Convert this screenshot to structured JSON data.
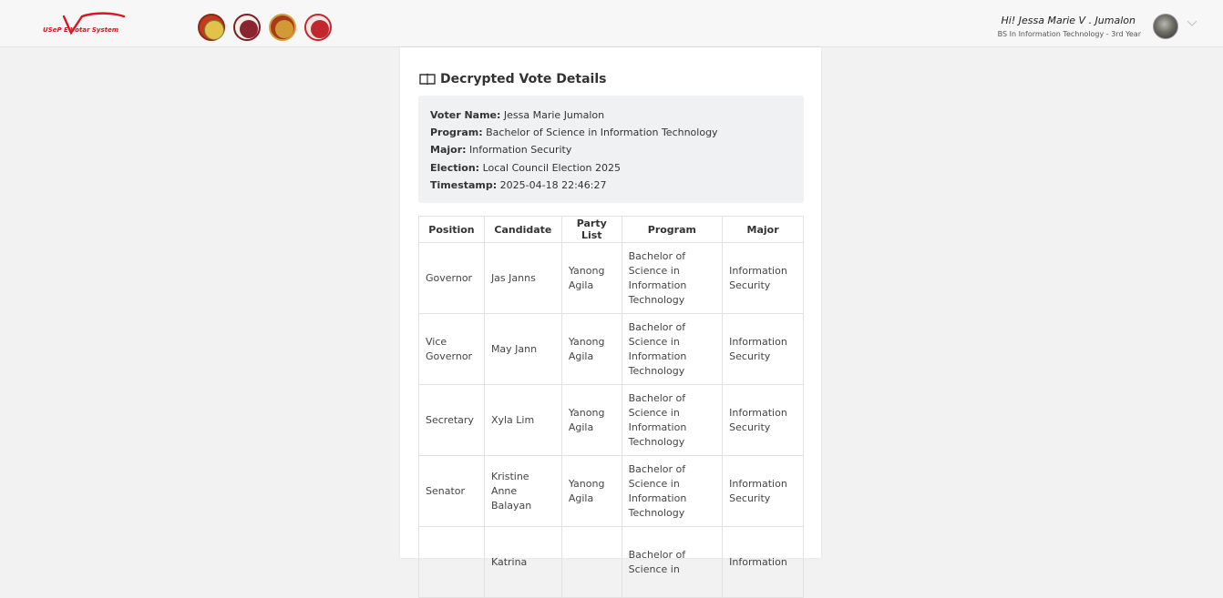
{
  "header": {
    "logo_text": "USeP E-Votar System",
    "user_greeting": "Hi! Jessa Marie V . Jumalon",
    "user_program": "BS In Information Technology - 3rd Year"
  },
  "colors": {
    "brand_red": "#d31a21",
    "page_bg": "#f2f2f2",
    "card_bg": "#ffffff",
    "info_bg": "#f0f1f3"
  },
  "icons": {
    "title": "book-open-icon",
    "dropdown": "chevron-down-icon"
  },
  "card": {
    "title": "Decrypted Vote Details",
    "info": {
      "voter_name_label": "Voter Name:",
      "voter_name": "Jessa Marie Jumalon",
      "program_label": "Program:",
      "program": "Bachelor of Science in Information Technology",
      "major_label": "Major:",
      "major": "Information Security",
      "election_label": "Election:",
      "election": "Local Council Election 2025",
      "timestamp_label": "Timestamp:",
      "timestamp": "2025-04-18 22:46:27"
    },
    "table": {
      "headers": [
        "Position",
        "Candidate",
        "Party List",
        "Program",
        "Major"
      ],
      "rows": [
        [
          "Governor",
          "Jas Janns",
          "Yanong Agila",
          "Bachelor of Science in Information Technology",
          "Information Security"
        ],
        [
          "Vice Governor",
          "May Jann",
          "Yanong Agila",
          "Bachelor of Science in Information Technology",
          "Information Security"
        ],
        [
          "Secretary",
          "Xyla Lim",
          "Yanong Agila",
          "Bachelor of Science in Information Technology",
          "Information Security"
        ],
        [
          "Senator",
          "Kristine Anne Balayan",
          "Yanong Agila",
          "Bachelor of Science in Information Technology",
          "Information Security"
        ],
        [
          "",
          "Katrina",
          "",
          "Bachelor of Science in",
          "Information"
        ]
      ]
    }
  }
}
